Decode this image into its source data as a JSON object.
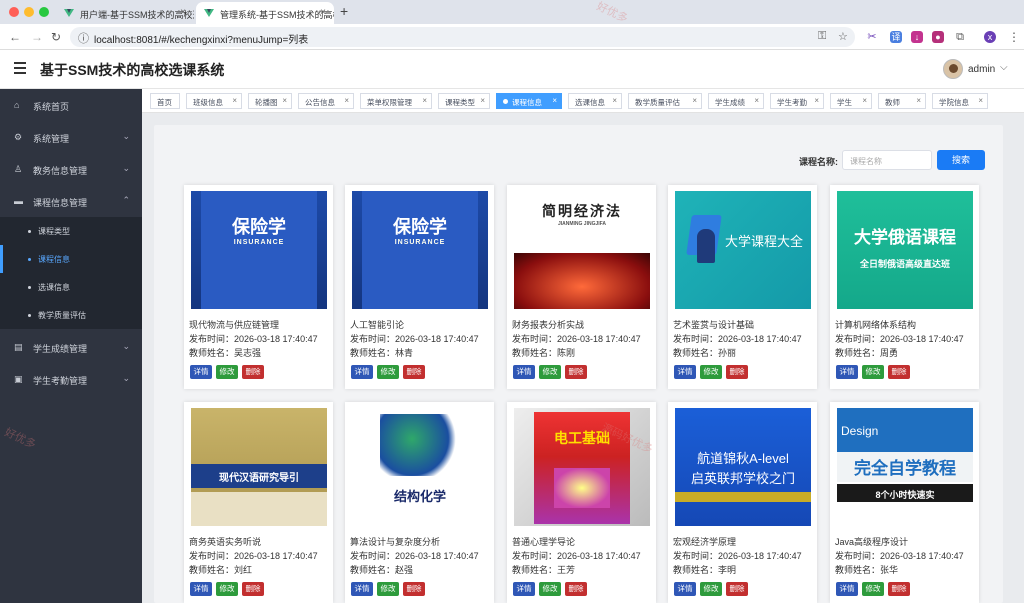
{
  "browser": {
    "tabs": [
      {
        "title": "用户端-基于SSM技术的高校选",
        "active": false
      },
      {
        "title": "管理系统-基于SSM技术的高校",
        "active": true
      }
    ],
    "url": "localhost:8081/#/kechengxinxi?menuJump=列表"
  },
  "header": {
    "title": "基于SSM技术的高校选课系统",
    "username": "admin"
  },
  "sidebar": {
    "menus": [
      {
        "label": "系统首页",
        "icon": "home-icon",
        "expandable": false
      },
      {
        "label": "系统管理",
        "icon": "gear-icon",
        "expandable": true
      },
      {
        "label": "教务信息管理",
        "icon": "user-icon",
        "expandable": true
      },
      {
        "label": "课程信息管理",
        "icon": "book-icon",
        "expandable": true,
        "open": true
      },
      {
        "label": "学生成绩管理",
        "icon": "grade-icon",
        "expandable": true
      },
      {
        "label": "学生考勤管理",
        "icon": "calendar-icon",
        "expandable": true
      }
    ],
    "submenu": [
      {
        "label": "课程类型",
        "active": false
      },
      {
        "label": "课程信息",
        "active": true
      },
      {
        "label": "选课信息",
        "active": false
      },
      {
        "label": "教学质量评估",
        "active": false
      }
    ]
  },
  "tags": [
    "首页",
    "班级信息",
    "轮播图",
    "公告信息",
    "菜单权限管理",
    "课程类型",
    "课程信息",
    "选课信息",
    "教学质量评估",
    "学生成绩",
    "学生考勤",
    "学生",
    "教师",
    "学院信息"
  ],
  "active_tag": "课程信息",
  "search": {
    "label": "课程名称:",
    "placeholder": "课程名称",
    "button": "搜索"
  },
  "card_labels": {
    "time_prefix": "发布时间：",
    "teacher_prefix": "教师姓名：",
    "detail": "详情",
    "edit": "修改",
    "delete": "删除"
  },
  "cards": [
    {
      "title": "现代物流与供应链管理",
      "time": "2026-03-18 17:40:47",
      "teacher": "吴志强",
      "cover": "insurance",
      "cover_text": "保险学",
      "cover_sub": "INSURANCE"
    },
    {
      "title": "人工智能引论",
      "time": "2026-03-18 17:40:47",
      "teacher": "林青",
      "cover": "insurance",
      "cover_text": "保险学",
      "cover_sub": "INSURANCE"
    },
    {
      "title": "财务报表分析实战",
      "time": "2026-03-18 17:40:47",
      "teacher": "陈刚",
      "cover": "economics",
      "cover_text": "简明经济法",
      "cover_sub": "JIANMING JINGJIFA"
    },
    {
      "title": "艺术鉴赏与设计基础",
      "time": "2026-03-18 17:40:47",
      "teacher": "孙丽",
      "cover": "course",
      "cover_text": "大学课程大全",
      "cover_sub": ""
    },
    {
      "title": "计算机网络体系结构",
      "time": "2026-03-18 17:40:47",
      "teacher": "周勇",
      "cover": "russian",
      "cover_text": "大学俄语课程",
      "cover_sub": "全日制俄语高级直达班"
    },
    {
      "title": "商务英语实务听说",
      "time": "2026-03-18 17:40:47",
      "teacher": "刘红",
      "cover": "chinese",
      "cover_text": "现代汉语研究导引",
      "cover_sub": ""
    },
    {
      "title": "算法设计与复杂度分析",
      "time": "2026-03-18 17:40:47",
      "teacher": "赵强",
      "cover": "chemistry",
      "cover_text": "结构化学",
      "cover_sub": ""
    },
    {
      "title": "普通心理学导论",
      "time": "2026-03-18 17:40:47",
      "teacher": "王芳",
      "cover": "electric",
      "cover_text": "电工基础",
      "cover_sub": ""
    },
    {
      "title": "宏观经济学原理",
      "time": "2026-03-18 17:40:47",
      "teacher": "李明",
      "cover": "alevel",
      "cover_text": "航道锦秋A-level",
      "cover_sub": "启英联邦学校之门"
    },
    {
      "title": "Java高级程序设计",
      "time": "2026-03-18 17:40:47",
      "teacher": "张华",
      "cover": "design",
      "cover_text": "完全自学教程",
      "cover_sub": "8个小时快速实"
    }
  ]
}
